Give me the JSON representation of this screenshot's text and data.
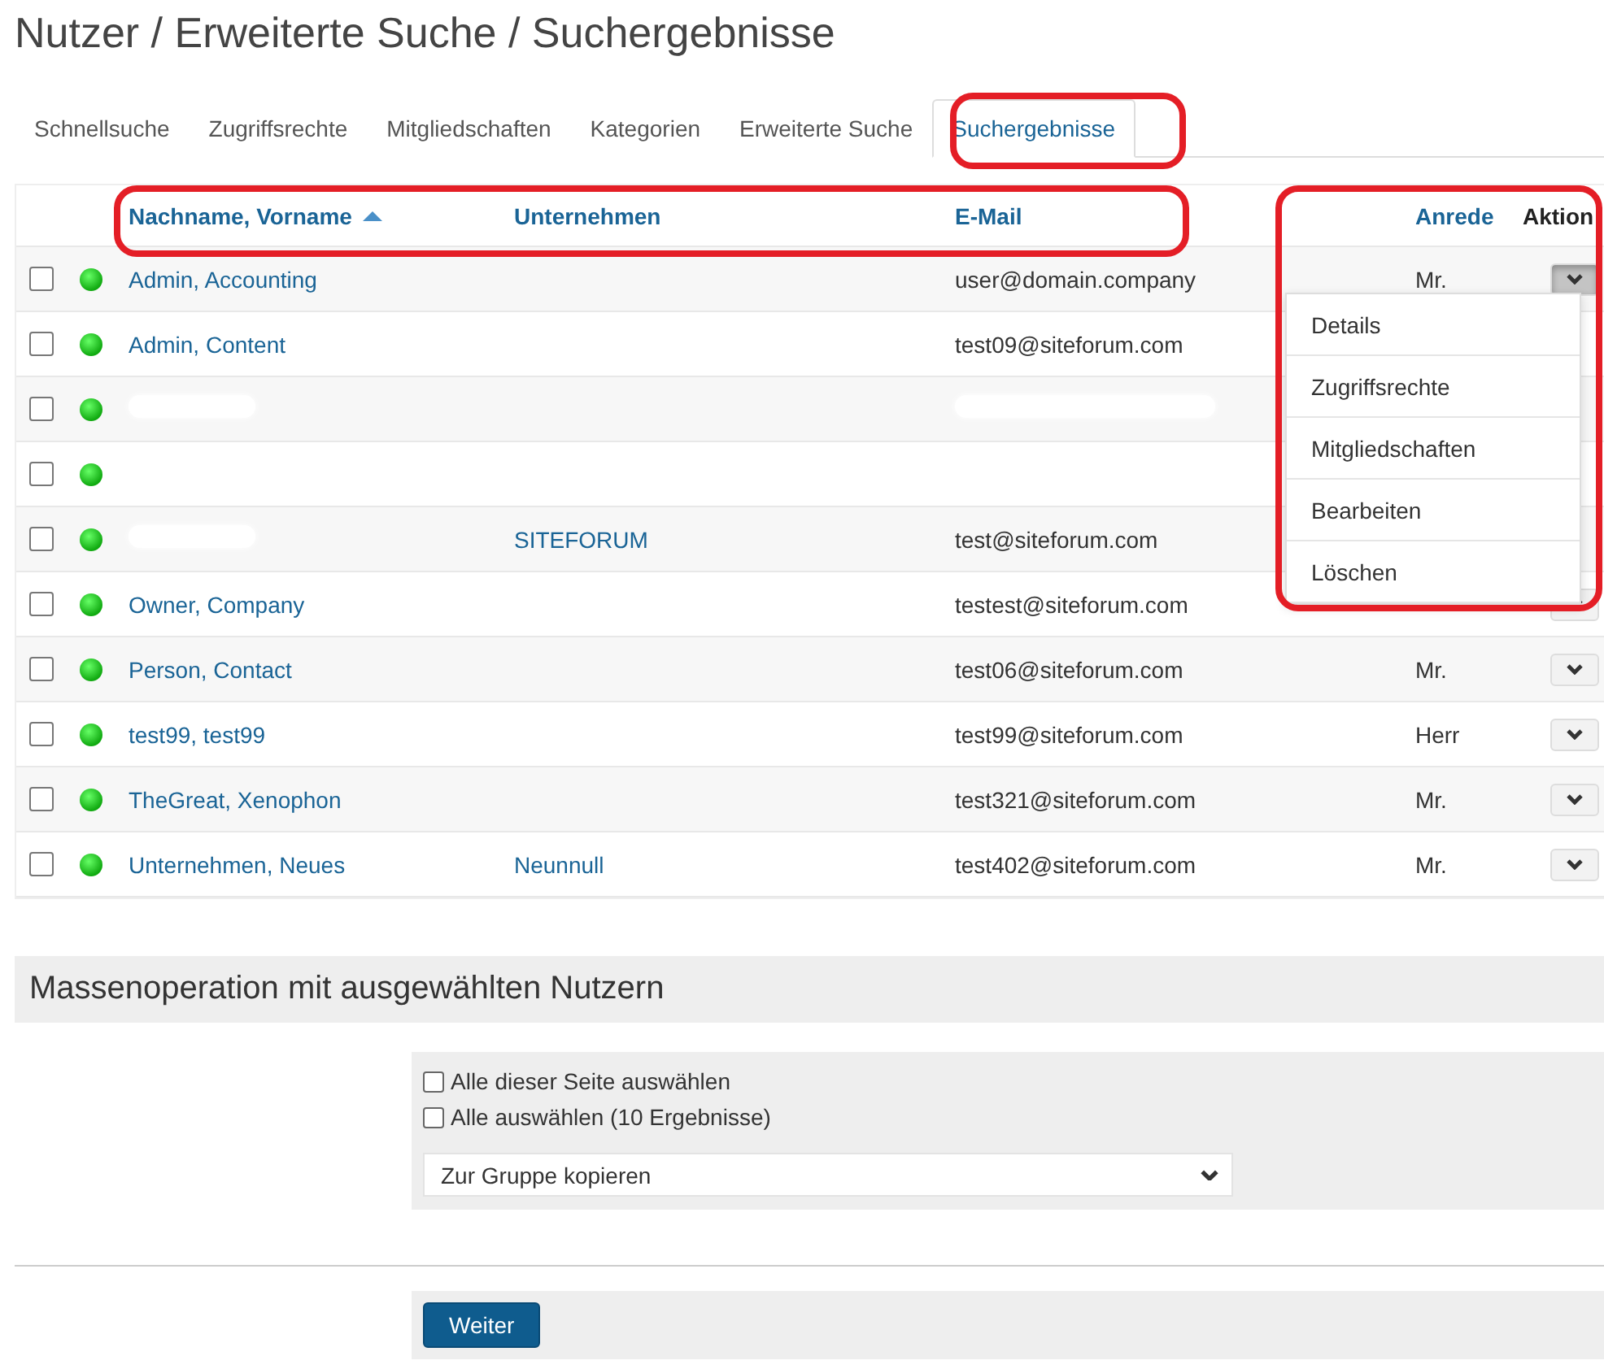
{
  "title": "Nutzer / Erweiterte Suche / Suchergebnisse",
  "tabs": [
    {
      "label": "Schnellsuche",
      "selected": false
    },
    {
      "label": "Zugriffsrechte",
      "selected": false
    },
    {
      "label": "Mitgliedschaften",
      "selected": false
    },
    {
      "label": "Kategorien",
      "selected": false
    },
    {
      "label": "Erweiterte Suche",
      "selected": false
    },
    {
      "label": "Suchergebnisse",
      "selected": true
    }
  ],
  "table": {
    "columns": [
      {
        "label": "Nachname, Vorname",
        "sorted": true
      },
      {
        "label": "Unternehmen"
      },
      {
        "label": "E-Mail"
      },
      {
        "label": "Anrede"
      },
      {
        "label": "Aktion"
      }
    ],
    "rows": [
      {
        "checked": false,
        "name": "Admin, Accounting",
        "email": "user@domain.company",
        "anrede": "Mr.",
        "action": true,
        "menu_open": true
      },
      {
        "checked": false,
        "name": "Admin, Content",
        "email": "test09@siteforum.com",
        "action": false
      },
      {
        "checked": false,
        "name_redacted": true,
        "email_redacted": true,
        "action": false
      },
      {
        "checked": false,
        "action": false
      },
      {
        "checked": false,
        "name_redacted": true,
        "company": "SITEFORUM",
        "email": "test@siteforum.com",
        "action": false
      },
      {
        "checked": false,
        "name": "Owner, Company",
        "email": "testest@siteforum.com",
        "action": true,
        "menu_open": false
      },
      {
        "checked": false,
        "name": "Person, Contact",
        "email": "test06@siteforum.com",
        "anrede": "Mr.",
        "action": true,
        "menu_open": false
      },
      {
        "checked": false,
        "name": "test99, test99",
        "email": "test99@siteforum.com",
        "anrede": "Herr",
        "action": true,
        "menu_open": false
      },
      {
        "checked": false,
        "name": "TheGreat, Xenophon",
        "email": "test321@siteforum.com",
        "anrede": "Mr.",
        "action": true,
        "menu_open": false
      },
      {
        "checked": false,
        "name": "Unternehmen, Neues",
        "company": "Neunnull",
        "email": "test402@siteforum.com",
        "anrede": "Mr.",
        "action": true,
        "menu_open": false
      }
    ]
  },
  "action_menu": [
    "Details",
    "Zugriffsrechte",
    "Mitgliedschaften",
    "Bearbeiten",
    "Löschen"
  ],
  "bulk": {
    "title": "Massenoperation mit ausgewählten Nutzern",
    "options": [
      {
        "label": "Alle dieser Seite auswählen",
        "checked": false
      },
      {
        "label": "Alle auswählen (10 Ergebnisse)",
        "checked": false
      }
    ],
    "select": "Zur Gruppe kopieren",
    "button": "Weiter"
  }
}
